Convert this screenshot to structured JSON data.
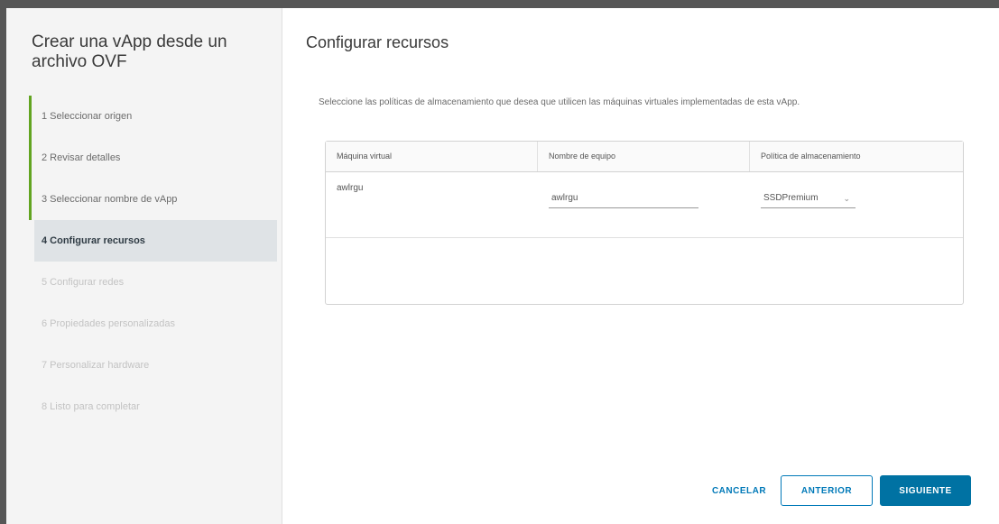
{
  "wizard": {
    "title": "Crear una vApp desde un archivo OVF",
    "steps": [
      {
        "label": "1  Seleccionar origen",
        "state": "done"
      },
      {
        "label": "2  Revisar detalles",
        "state": "done"
      },
      {
        "label": "3  Seleccionar nombre de vApp",
        "state": "done"
      },
      {
        "label": "4  Configurar recursos",
        "state": "current"
      },
      {
        "label": "5  Configurar redes",
        "state": "pending"
      },
      {
        "label": "6  Propiedades personalizadas",
        "state": "pending"
      },
      {
        "label": "7  Personalizar hardware",
        "state": "pending"
      },
      {
        "label": "8  Listo para completar",
        "state": "pending"
      }
    ]
  },
  "main": {
    "title": "Configurar recursos",
    "description": "Seleccione las políticas de almacenamiento que desea que utilicen las máquinas virtuales implementadas de esta vApp.",
    "table": {
      "headers": [
        "Máquina virtual",
        "Nombre de equipo",
        "Política de almacenamiento"
      ],
      "rows": [
        {
          "vm": "awlrgu",
          "computer_name": "awlrgu",
          "policy": "SSDPremium"
        }
      ]
    }
  },
  "footer": {
    "cancel": "CANCELAR",
    "previous": "ANTERIOR",
    "next": "SIGUIENTE"
  },
  "colors": {
    "done_bar": "#62a420",
    "primary": "#0072a3",
    "link": "#0079b8"
  }
}
